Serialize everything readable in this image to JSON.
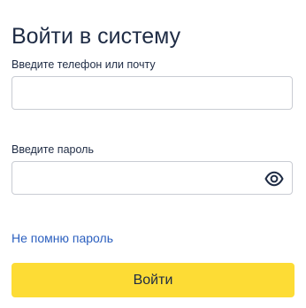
{
  "page": {
    "title": "Войти в систему"
  },
  "form": {
    "login": {
      "label": "Введите телефон или почту",
      "value": "",
      "placeholder": ""
    },
    "password": {
      "label": "Введите пароль",
      "value": "",
      "placeholder": "",
      "toggle_icon": "eye-icon"
    },
    "forgot_link": "Не помню пароль",
    "submit_label": "Войти"
  },
  "colors": {
    "accent_button": "#fddc35",
    "link": "#2b5fbf",
    "text": "#1e2b44",
    "border": "#c9ccd3"
  }
}
